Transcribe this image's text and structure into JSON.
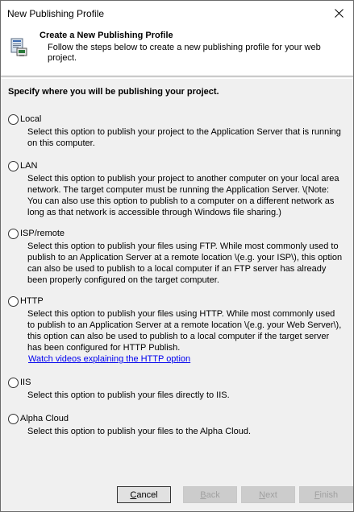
{
  "window": {
    "title": "New Publishing Profile"
  },
  "header": {
    "title": "Create a New Publishing Profile",
    "description": "Follow the steps below to create a new publishing profile for your web project."
  },
  "section_title": "Specify where you will be publishing your project.",
  "options": [
    {
      "label": "Local",
      "description": "Select this option to publish your project to the Application Server that is running on this computer."
    },
    {
      "label": "LAN",
      "description": "Select this option to publish your project to another computer on your local area network.  The target computer must be running the Application Server. \\(Note: You can also use this option to publish to a computer on a different network as long as that network is accessible through Windows file sharing.)"
    },
    {
      "label": "ISP/remote",
      "description": "Select this option to publish your files using FTP. While most commonly used to publish to an Application Server at a remote location \\(e.g. your ISP\\), this option can also be used to publish to a local computer if an FTP server has already been properly configured on the target computer."
    },
    {
      "label": "HTTP",
      "description": "Select this option to publish your files using HTTP. While most commonly used to publish to an Application Server at a remote location \\(e.g. your Web Server\\), this option can also be used to publish to a local computer if the target server has been configured for HTTP Publish.",
      "link": "Watch videos explaining the HTTP option"
    },
    {
      "label": "IIS",
      "description": "Select this option to publish your files directly to IIS."
    },
    {
      "label": "Alpha Cloud",
      "description": "Select this option to publish your files to the Alpha Cloud."
    }
  ],
  "buttons": {
    "cancel": {
      "prefix": "",
      "mnemonic": "C",
      "rest": "ancel"
    },
    "back": {
      "prefix": "",
      "mnemonic": "B",
      "rest": "ack"
    },
    "next": {
      "prefix": "",
      "mnemonic": "N",
      "rest": "ext"
    },
    "finish": {
      "prefix": "",
      "mnemonic": "F",
      "rest": "inish"
    }
  }
}
